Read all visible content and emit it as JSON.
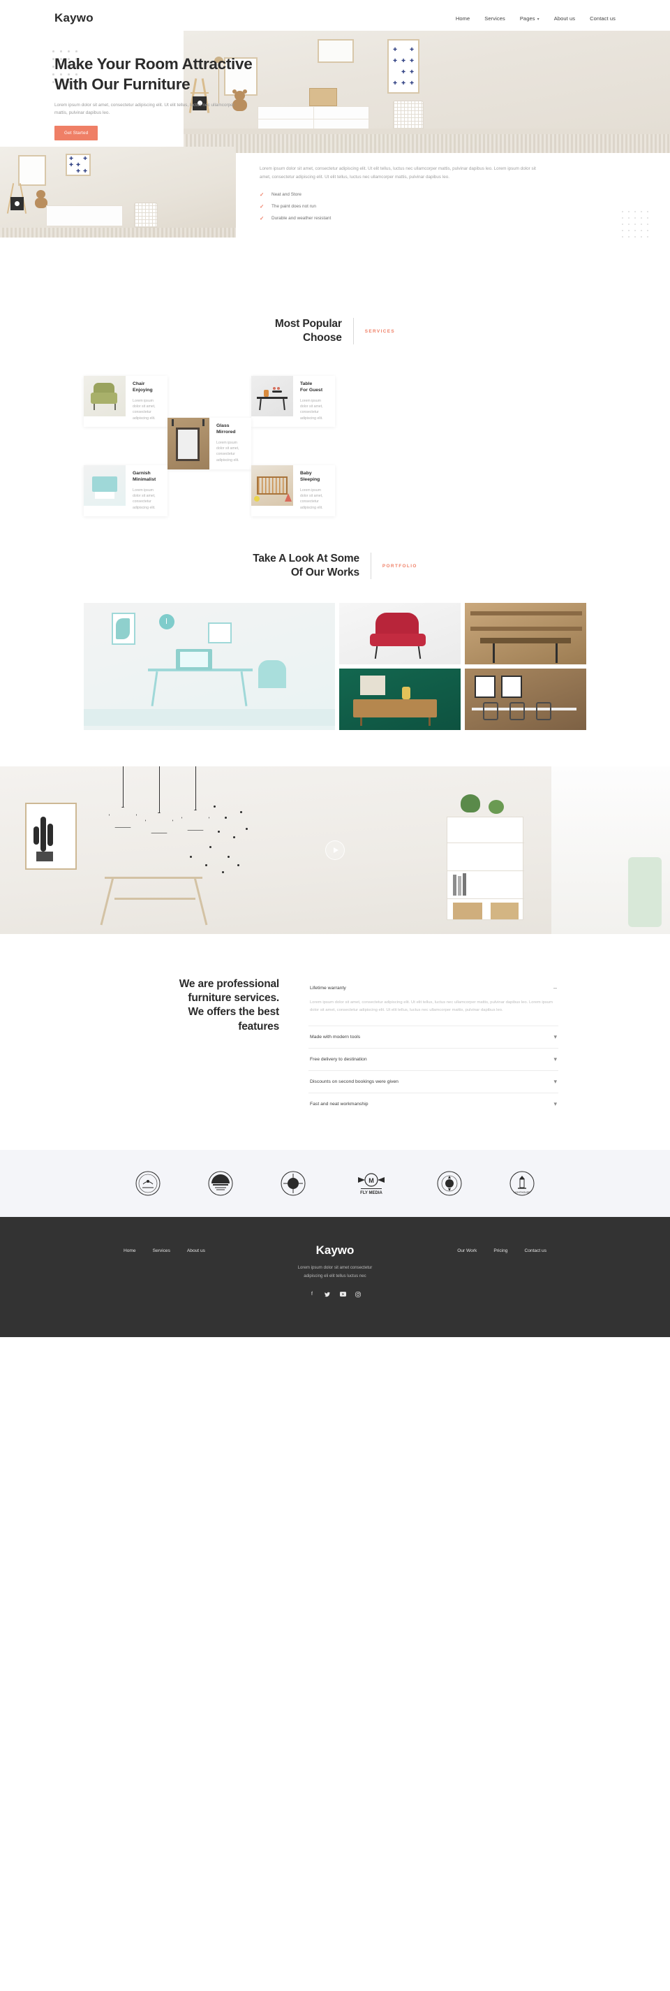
{
  "brand": {
    "name": "Kaywo"
  },
  "colors": {
    "accent": "#ef7f66",
    "dark": "#2b2b2b",
    "footer_bg": "#333333",
    "muted": "#a0a0a0"
  },
  "header": {
    "nav": [
      {
        "label": "Home"
      },
      {
        "label": "Services"
      },
      {
        "label": "Pages",
        "has_dropdown": true,
        "caret": "⌄"
      },
      {
        "label": "About us"
      },
      {
        "label": "Contact us"
      }
    ]
  },
  "hero": {
    "title_line1": "Make Your Room Attractive",
    "title_line2": "With Our Furniture",
    "description": "Lorem ipsum dolor sit amet, consectetur adipiscing elit. Ut elit tellus, luctus nec ullamcorper mattis, pulvinar dapibus leo.",
    "cta_label": "Get Started"
  },
  "about": {
    "paragraph": "Lorem ipsum dolor sit amet, consectetur adipiscing elit. Ut elit tellus, luctus nec ullamcorper mattis, pulvinar dapibus leo. Lorem ipsum dolor sit amet, consectetur adipiscing elit. Ut elit tellus, luctus nec ullamcorper mattis, pulvinar dapibus leo.",
    "check_icon": "✓",
    "features": [
      {
        "label": "Neat and Store"
      },
      {
        "label": "The paint does not run"
      },
      {
        "label": "Durable and weather resistant"
      }
    ]
  },
  "services": {
    "heading_line1": "Most Popular",
    "heading_line2": "Choose",
    "tag": "SERVICES",
    "cards": [
      {
        "title_line1": "Chair",
        "title_line2": "Enjoying",
        "text": "Lorem ipsum dolor sit amet, consectetur adipiscing elit."
      },
      {
        "title_line1": "Table",
        "title_line2": "For Guest",
        "text": "Lorem ipsum dolor sit amet, consectetur adipiscing elit."
      },
      {
        "title_line1": "Glass",
        "title_line2": "Mirrored",
        "text": "Lorem ipsum dolor sit amet, consectetur adipiscing elit."
      },
      {
        "title_line1": "Garnish",
        "title_line2": "Minimalist",
        "text": "Lorem ipsum dolor sit amet, consectetur adipiscing elit."
      },
      {
        "title_line1": "Baby",
        "title_line2": "Sleeping",
        "text": "Lorem ipsum dolor sit amet, consectetur adipiscing elit."
      }
    ]
  },
  "portfolio": {
    "heading_line1": "Take A Look At Some",
    "heading_line2": "Of Our Works",
    "tag": "PORTFOLIO"
  },
  "video": {
    "play_label": "play-button"
  },
  "faq": {
    "heading_line1": "We are professional",
    "heading_line2": "furniture services.",
    "heading_line3": "We offers the best",
    "heading_line4": "features",
    "items": [
      {
        "question": "Lifetime warranty",
        "open": true,
        "sign": "–",
        "answer": "Lorem ipsum dolor sit amet, consectetur adipiscing elit. Ut elit tellus, luctus nec ullamcorper mattis, pulvinar dapibus leo. Lorem ipsum dolor sit amet, consectetur adipiscing elit. Ut elit tellus, luctus nec ullamcorper mattis, pulvinar dapibus leo."
      },
      {
        "question": "Made with modern tools",
        "open": false,
        "sign": "⌄",
        "answer": ""
      },
      {
        "question": "Free delivery to destination",
        "open": false,
        "sign": "⌄",
        "answer": ""
      },
      {
        "question": "Discounts on second bookings were given",
        "open": false,
        "sign": "⌄",
        "answer": ""
      },
      {
        "question": "Fast and neat workmanship",
        "open": false,
        "sign": "⌄",
        "answer": ""
      }
    ]
  },
  "brands": [
    {
      "name": "TOP ISLAND COFFEE"
    },
    {
      "name": "SEA FRESH"
    },
    {
      "name": "MY LITTLE MILL"
    },
    {
      "name": "FLY MEDIA"
    },
    {
      "name": "STAR FLOWERS"
    },
    {
      "name": "LIGHTHOUSE"
    }
  ],
  "footer": {
    "nav_left": [
      {
        "label": "Home"
      },
      {
        "label": "Services"
      },
      {
        "label": "About us"
      }
    ],
    "nav_right": [
      {
        "label": "Our Work"
      },
      {
        "label": "Pricing"
      },
      {
        "label": "Contact us"
      }
    ],
    "logo": "Kaywo",
    "description_line1": "Lorem ipsum dolor sit amet consectetur",
    "description_line2": "adipiscing eli elit tellus luctus nec",
    "social": [
      {
        "name": "facebook",
        "glyph": "f"
      },
      {
        "name": "twitter",
        "glyph": "ᵛ"
      },
      {
        "name": "youtube",
        "glyph": "■"
      },
      {
        "name": "instagram",
        "glyph": "◎"
      }
    ]
  }
}
